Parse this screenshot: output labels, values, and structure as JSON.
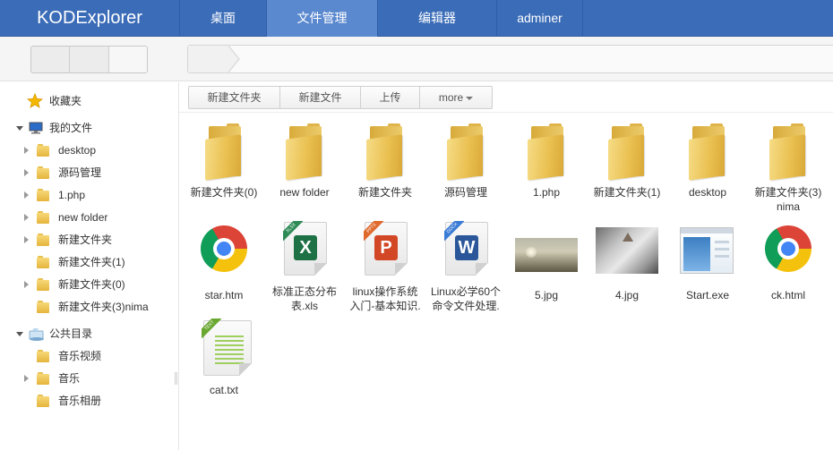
{
  "app": {
    "logo": "KODExplorer"
  },
  "nav": {
    "tabs": [
      {
        "label": "桌面"
      },
      {
        "label": "文件管理"
      },
      {
        "label": "编辑器"
      },
      {
        "label": "adminer"
      }
    ],
    "active_index": 1
  },
  "sidebar": {
    "favorites": {
      "label": "收藏夹",
      "icon": "star-icon"
    },
    "my_files": {
      "label": "我的文件",
      "icon": "computer-icon",
      "items": [
        {
          "label": "desktop",
          "expandable": true
        },
        {
          "label": "源码管理",
          "expandable": true
        },
        {
          "label": "1.php",
          "expandable": true
        },
        {
          "label": "new folder",
          "expandable": true
        },
        {
          "label": "新建文件夹",
          "expandable": true
        },
        {
          "label": "新建文件夹(1)",
          "expandable": false
        },
        {
          "label": "新建文件夹(0)",
          "expandable": true
        },
        {
          "label": "新建文件夹(3)nima",
          "expandable": false
        }
      ]
    },
    "public": {
      "label": "公共目录",
      "icon": "shared-folder-icon",
      "items": [
        {
          "label": "音乐视频",
          "expandable": false
        },
        {
          "label": "音乐",
          "expandable": true
        },
        {
          "label": "音乐相册",
          "expandable": false
        }
      ]
    }
  },
  "toolbar": {
    "new_folder": "新建文件夹",
    "new_file": "新建文件",
    "upload": "上传",
    "more": "more"
  },
  "files": [
    {
      "name": "新建文件夹(0)",
      "type": "folder"
    },
    {
      "name": "new folder",
      "type": "folder"
    },
    {
      "name": "新建文件夹",
      "type": "folder"
    },
    {
      "name": "源码管理",
      "type": "folder"
    },
    {
      "name": "1.php",
      "type": "folder"
    },
    {
      "name": "新建文件夹(1)",
      "type": "folder"
    },
    {
      "name": "desktop",
      "type": "folder"
    },
    {
      "name": "新建文件夹(3)",
      "name2": "nima",
      "type": "folder"
    },
    {
      "name": "star.htm",
      "type": "chrome"
    },
    {
      "name": "标准正态分布",
      "name2": "表.xls",
      "type": "xlsx",
      "badge": "XLSX",
      "letter": "X",
      "color": "#1e7145",
      "ribbon": "#2e8b57"
    },
    {
      "name": "linux操作系统",
      "name2": "入门-基本知识.",
      "type": "pptx",
      "badge": "PPTX",
      "letter": "P",
      "color": "#d24726",
      "ribbon": "#e06a2c"
    },
    {
      "name": "Linux必学60个",
      "name2": "命令文件处理.",
      "type": "docx",
      "badge": "DOCX",
      "letter": "W",
      "color": "#2b579a",
      "ribbon": "#3a7bd5"
    },
    {
      "name": "5.jpg",
      "type": "image"
    },
    {
      "name": "4.jpg",
      "type": "image"
    },
    {
      "name": "Start.exe",
      "type": "exe"
    },
    {
      "name": "ck.html",
      "type": "chrome"
    },
    {
      "name": "cat.txt",
      "type": "txt",
      "badge": "TEXT"
    }
  ]
}
